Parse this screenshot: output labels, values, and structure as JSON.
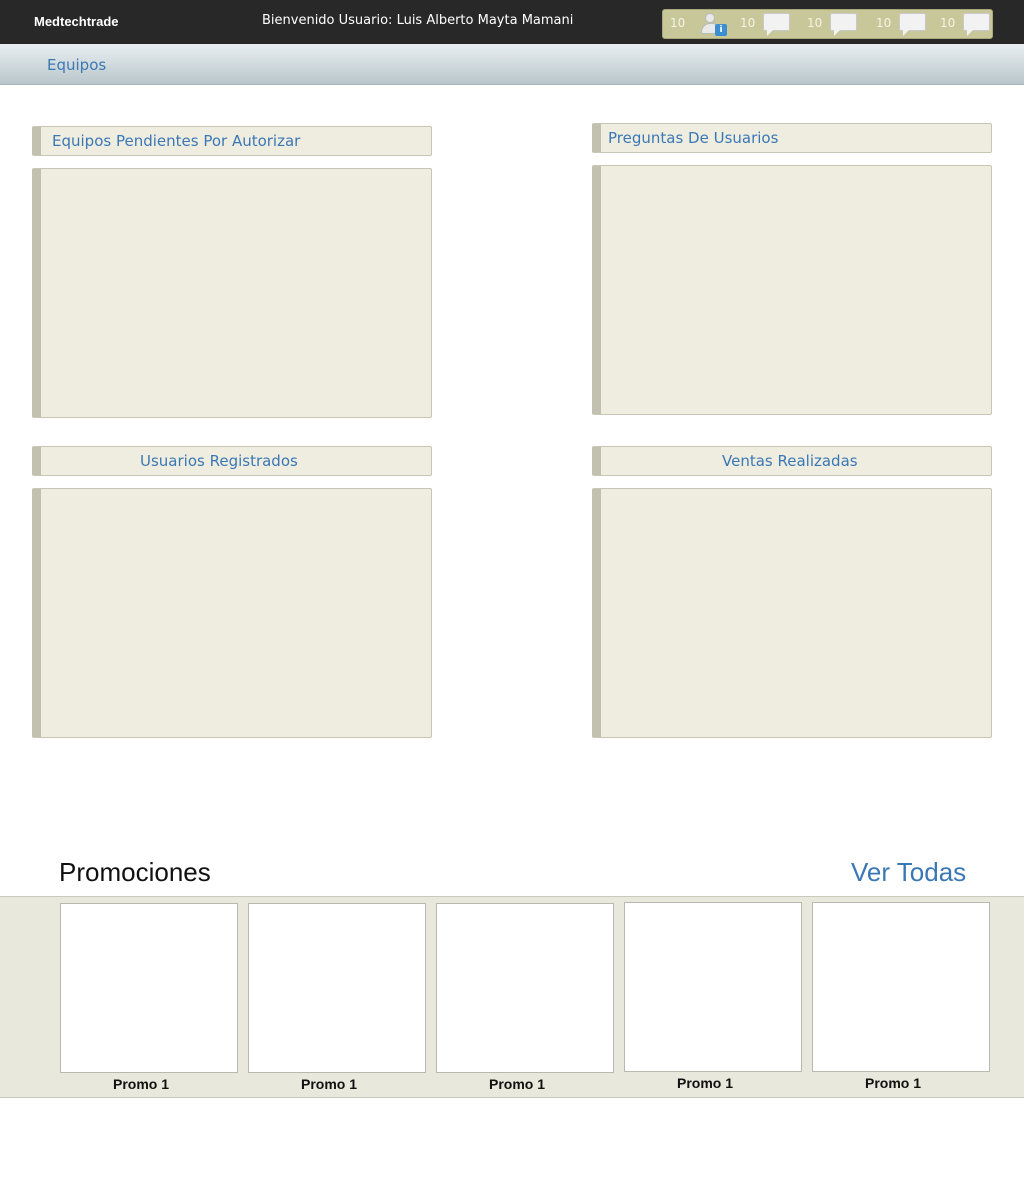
{
  "topbar": {
    "brand": "Medtechtrade",
    "welcome": "Bienvenido Usuario: Luis Alberto Mayta Mamani",
    "notifications": [
      {
        "count": "10",
        "icon": "user-info-icon"
      },
      {
        "count": "10",
        "icon": "speech-bubble-icon"
      },
      {
        "count": "10",
        "icon": "speech-bubble-icon"
      },
      {
        "count": "10",
        "icon": "speech-bubble-icon"
      },
      {
        "count": "10",
        "icon": "speech-bubble-icon"
      }
    ]
  },
  "nav": {
    "items": [
      {
        "label": "Equipos"
      }
    ]
  },
  "panels": [
    {
      "title": "Equipos Pendientes Por Autorizar"
    },
    {
      "title": "Preguntas De Usuarios"
    },
    {
      "title": "Usuarios Registrados"
    },
    {
      "title": "Ventas Realizadas"
    }
  ],
  "promotions": {
    "title": "Promociones",
    "view_all": "Ver Todas",
    "items": [
      {
        "label": "Promo 1"
      },
      {
        "label": "Promo 1"
      },
      {
        "label": "Promo 1"
      },
      {
        "label": "Promo 1"
      },
      {
        "label": "Promo 1"
      }
    ]
  },
  "colors": {
    "topbar": "#282828",
    "accent_link": "#3a78b5",
    "panel_bg": "#efede0",
    "notif_bg": "#c8c79a"
  }
}
